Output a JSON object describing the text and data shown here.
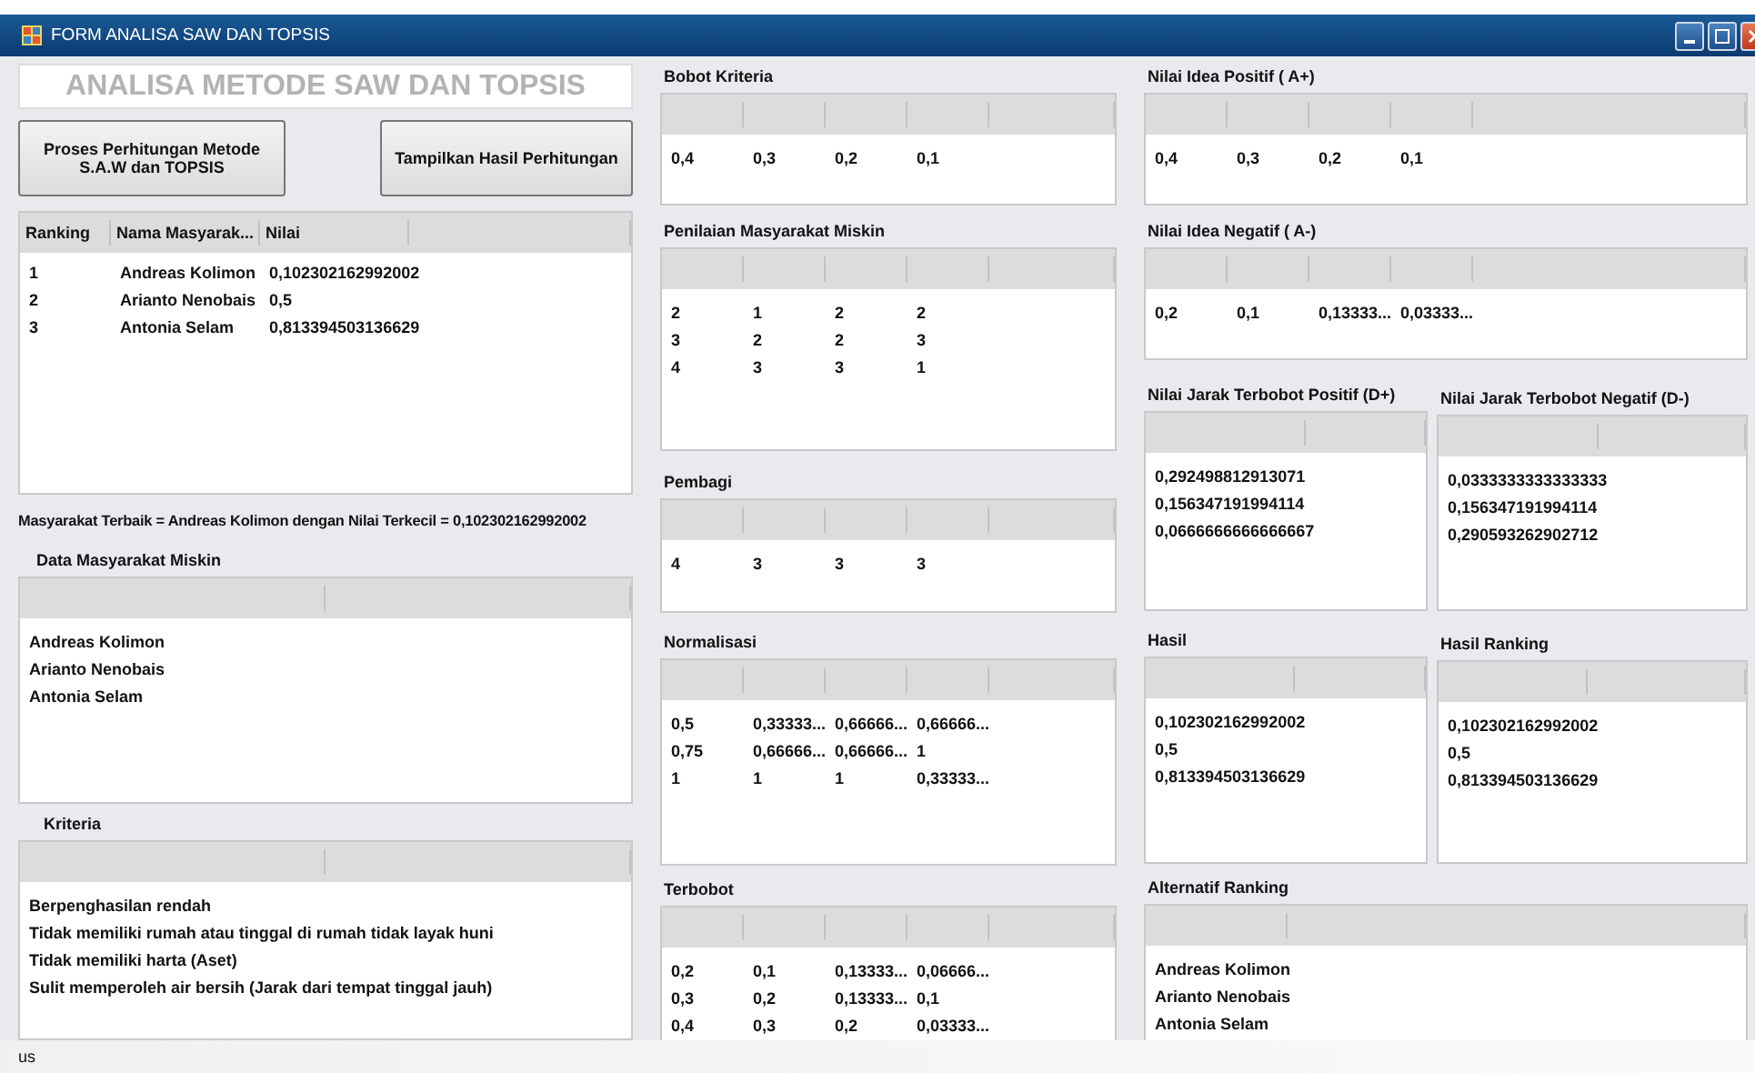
{
  "window": {
    "title": "FORM ANALISA SAW DAN TOPSIS"
  },
  "heading": "ANALISA METODE SAW DAN TOPSIS",
  "buttons": [
    {
      "label": "Proses Perhitungan Metode S.A.W dan TOPSIS"
    },
    {
      "label": "Tampilkan Hasil Perhitungan"
    }
  ],
  "ranking_list": {
    "columns": [
      "Ranking",
      "Nama Masyarak...",
      "Nilai"
    ],
    "rows": [
      [
        "1",
        "Andreas Kolimon",
        "0,102302162992002"
      ],
      [
        "2",
        "Arianto Nenobais",
        "0,5"
      ],
      [
        "3",
        "Antonia Selam",
        "0,813394503136629"
      ]
    ]
  },
  "result_message": "Masyarakat Terbaik = Andreas Kolimon dengan Nilai Terkecil = 0,102302162992002",
  "data_masyarakat": {
    "title": "Data Masyarakat Miskin",
    "rows": [
      [
        "Andreas Kolimon"
      ],
      [
        "Arianto Nenobais"
      ],
      [
        "Antonia Selam"
      ]
    ]
  },
  "kriteria": {
    "title": "Kriteria",
    "rows": [
      [
        "Berpenghasilan rendah"
      ],
      [
        "Tidak memiliki rumah atau tinggal di rumah tidak layak huni"
      ],
      [
        "Tidak memiliki harta (Aset)"
      ],
      [
        "Sulit memperoleh air bersih (Jarak dari tempat tinggal jauh)"
      ]
    ]
  },
  "bobot_kriteria": {
    "title": "Bobot Kriteria",
    "rows": [
      [
        "0,4",
        "0,3",
        "0,2",
        "0,1"
      ]
    ]
  },
  "penilaian": {
    "title": "Penilaian Masyarakat Miskin",
    "rows": [
      [
        "2",
        "1",
        "2",
        "2"
      ],
      [
        "3",
        "2",
        "2",
        "3"
      ],
      [
        "4",
        "3",
        "3",
        "1"
      ]
    ]
  },
  "pembagi": {
    "title": "Pembagi",
    "rows": [
      [
        "4",
        "3",
        "3",
        "3"
      ]
    ]
  },
  "normalisasi": {
    "title": "Normalisasi",
    "rows": [
      [
        "0,5",
        "0,33333...",
        "0,66666...",
        "0,66666..."
      ],
      [
        "0,75",
        "0,66666...",
        "0,66666...",
        "1"
      ],
      [
        "1",
        "1",
        "1",
        "0,33333..."
      ]
    ]
  },
  "terbobot": {
    "title": "Terbobot",
    "rows": [
      [
        "0,2",
        "0,1",
        "0,13333...",
        "0,06666..."
      ],
      [
        "0,3",
        "0,2",
        "0,13333...",
        "0,1"
      ],
      [
        "0,4",
        "0,3",
        "0,2",
        "0,03333..."
      ]
    ]
  },
  "idea_positif": {
    "title": "Nilai Idea Positif ( A+)",
    "rows": [
      [
        "0,4",
        "0,3",
        "0,2",
        "0,1"
      ]
    ]
  },
  "idea_negatif": {
    "title": "Nilai Idea Negatif ( A-)",
    "rows": [
      [
        "0,2",
        "0,1",
        "0,13333...",
        "0,03333..."
      ]
    ]
  },
  "jarak_positif": {
    "title": "Nilai Jarak Terbobot Positif (D+)",
    "rows": [
      [
        "0,292498812913071"
      ],
      [
        "0,156347191994114"
      ],
      [
        "0,0666666666666667"
      ]
    ]
  },
  "jarak_negatif": {
    "title": "Nilai Jarak Terbobot Negatif (D-)",
    "rows": [
      [
        "0,0333333333333333"
      ],
      [
        "0,156347191994114"
      ],
      [
        "0,290593262902712"
      ]
    ]
  },
  "hasil": {
    "title": "Hasil",
    "rows": [
      [
        "0,102302162992002"
      ],
      [
        "0,5"
      ],
      [
        "0,813394503136629"
      ]
    ]
  },
  "hasil_ranking": {
    "title": "Hasil Ranking",
    "rows": [
      [
        "0,102302162992002"
      ],
      [
        "0,5"
      ],
      [
        "0,813394503136629"
      ]
    ]
  },
  "alternatif_ranking": {
    "title": "Alternatif Ranking",
    "rows": [
      [
        "Andreas Kolimon"
      ],
      [
        "Arianto Nenobais"
      ],
      [
        "Antonia Selam"
      ]
    ]
  },
  "status_bar": "us"
}
